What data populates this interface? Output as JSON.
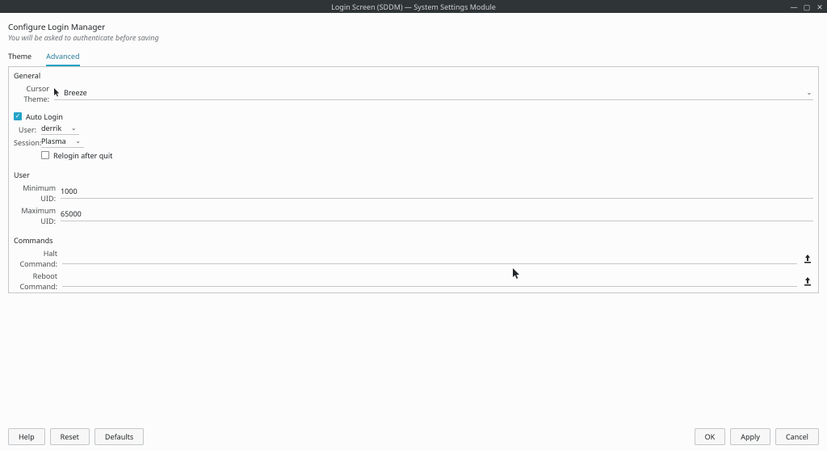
{
  "window": {
    "title": "Login Screen (SDDM) — System Settings Module"
  },
  "header": {
    "title": "Configure Login Manager",
    "subtitle": "You will be asked to authenticate before saving"
  },
  "tabs": {
    "theme": "Theme",
    "advanced": "Advanced",
    "active": "advanced"
  },
  "sections": {
    "general": {
      "title": "General",
      "cursor_theme_label": "Cursor Theme:",
      "cursor_theme_value": "Breeze",
      "auto_login_label": "Auto Login",
      "auto_login_checked": true,
      "user_label": "User:",
      "user_value": "derrik",
      "session_label": "Session:",
      "session_value": "Plasma",
      "relogin_label": "Relogin after quit",
      "relogin_checked": false
    },
    "user": {
      "title": "User",
      "min_uid_label": "Minimum UID:",
      "min_uid_value": "1000",
      "max_uid_label": "Maximum UID:",
      "max_uid_value": "65000"
    },
    "commands": {
      "title": "Commands",
      "halt_label": "Halt Command:",
      "halt_value": "",
      "reboot_label": "Reboot Command:",
      "reboot_value": ""
    }
  },
  "footer": {
    "help": "Help",
    "reset": "Reset",
    "defaults": "Defaults",
    "ok": "OK",
    "apply": "Apply",
    "cancel": "Cancel"
  }
}
